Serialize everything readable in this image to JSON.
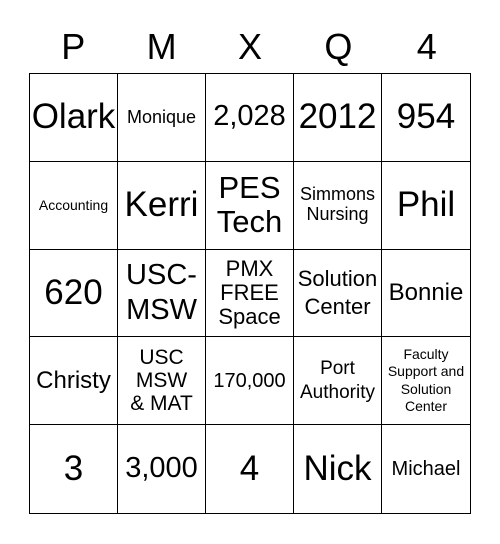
{
  "header": [
    "P",
    "M",
    "X",
    "Q",
    "4"
  ],
  "cells": [
    "Olark",
    "Monique",
    "2,028",
    "2012",
    "954",
    "Accounting",
    "Kerri",
    "PES Tech",
    "Simmons Nursing",
    "Phil",
    "620",
    "USC-MSW",
    "PMX FREE Space",
    "Solution Center",
    "Bonnie",
    "Christy",
    "USC MSW & MAT",
    "170,000",
    "Port Authority",
    "Faculty Support and Solution Center",
    "3",
    "3,000",
    "4",
    "Nick",
    "Michael"
  ]
}
